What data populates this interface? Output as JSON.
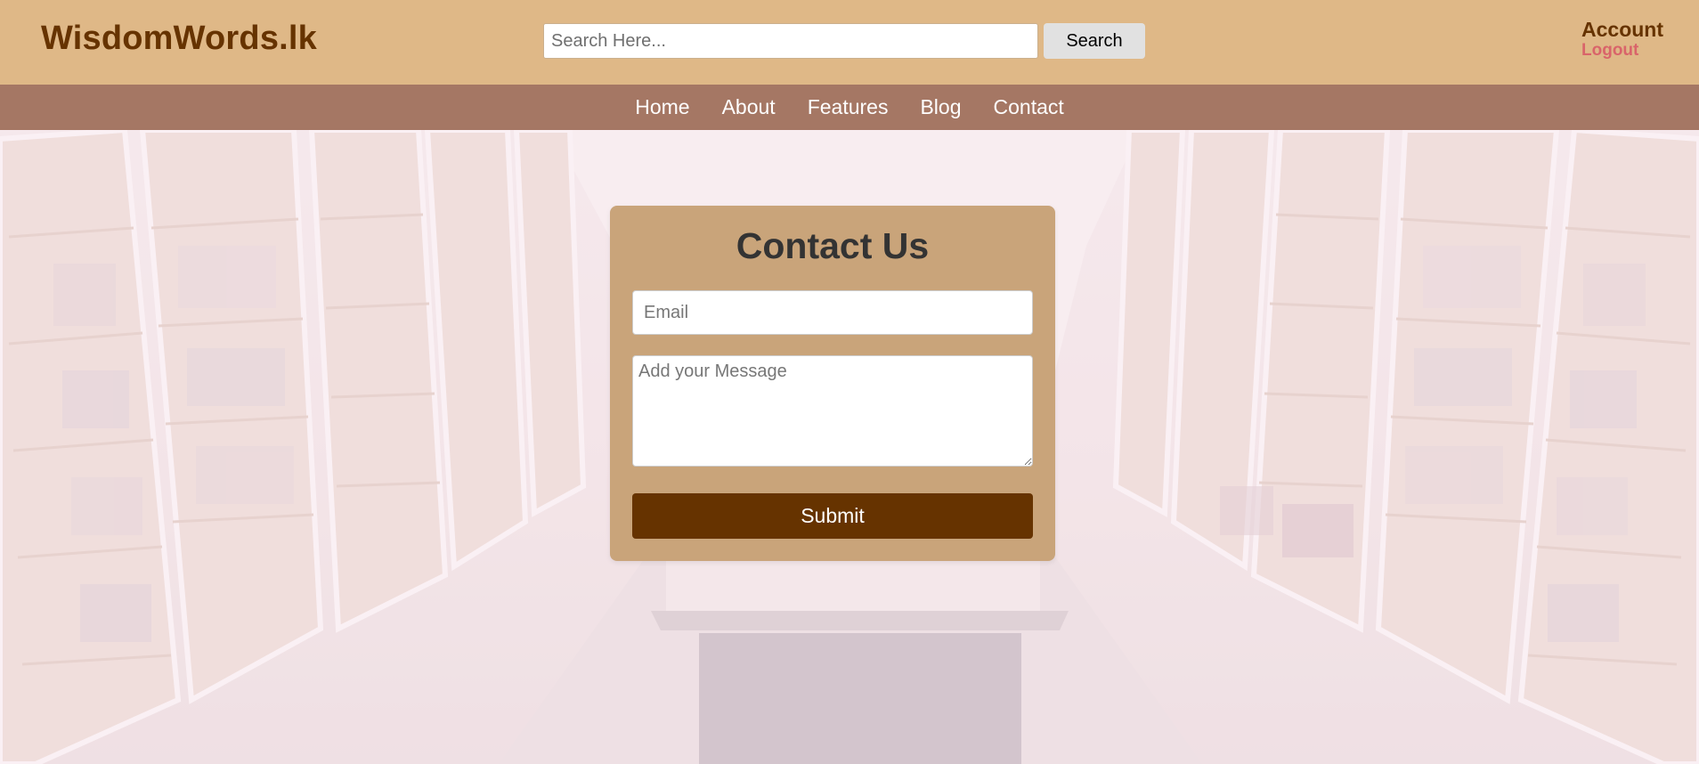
{
  "header": {
    "logo": "WisdomWords.lk",
    "search_placeholder": "Search Here...",
    "search_button": "Search",
    "account": "Account",
    "logout": "Logout"
  },
  "nav": {
    "items": [
      "Home",
      "About",
      "Features",
      "Blog",
      "Contact"
    ]
  },
  "contact": {
    "title": "Contact Us",
    "email_placeholder": "Email",
    "message_placeholder": "Add your Message",
    "submit": "Submit"
  },
  "colors": {
    "header_bg": "#dfb887",
    "nav_bg": "#a57764",
    "brand": "#663300",
    "logout": "#d9646a",
    "card_bg": "#c9a47a",
    "submit_bg": "#663300"
  },
  "hero": {
    "background": "library-bookshelves-image"
  }
}
